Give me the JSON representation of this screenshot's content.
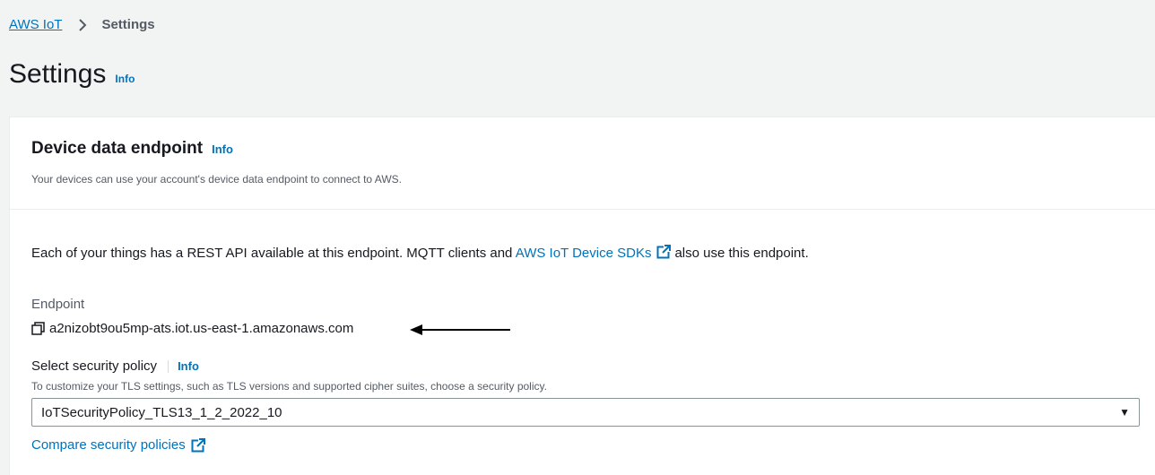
{
  "breadcrumb": {
    "root": "AWS IoT",
    "current": "Settings"
  },
  "page": {
    "title": "Settings",
    "info": "Info"
  },
  "section": {
    "title": "Device data endpoint",
    "info": "Info",
    "description": "Your devices can use your account's device data endpoint to connect to AWS."
  },
  "body": {
    "text_before": "Each of your things has a REST API available at this endpoint. MQTT clients and ",
    "sdk_link": "AWS IoT Device SDKs",
    "text_after": "also use this endpoint."
  },
  "endpoint": {
    "label": "Endpoint",
    "value": "a2nizobt9ou5mp-ats.iot.us-east-1.amazonaws.com"
  },
  "policy": {
    "label": "Select security policy",
    "info": "Info",
    "description": "To customize your TLS settings, such as TLS versions and supported cipher suites, choose a security policy.",
    "selected": "IoTSecurityPolicy_TLS13_1_2_2022_10",
    "caret": "▼",
    "compare_link": "Compare security policies"
  },
  "icons": [
    "chevron-right-icon",
    "copy-icon",
    "external-link-icon",
    "arrow-left-icon",
    "caret-down-icon"
  ],
  "colors": {
    "link": "#0073bb",
    "background": "#f2f3f3",
    "panel": "#ffffff"
  }
}
